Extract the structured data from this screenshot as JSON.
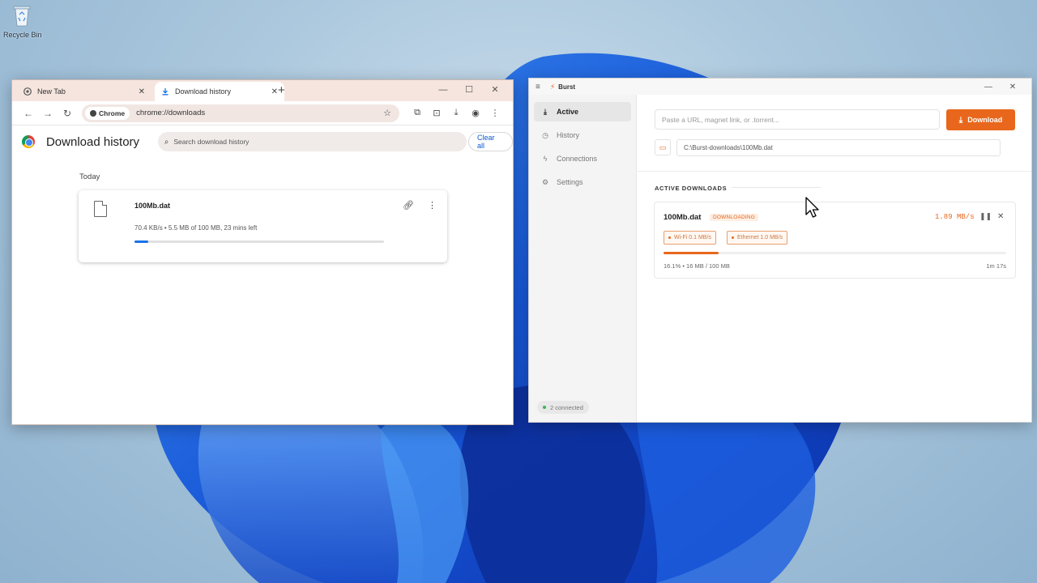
{
  "desktop": {
    "recycle_bin_label": "Recycle Bin"
  },
  "chrome": {
    "tabs": [
      {
        "label": "New Tab",
        "icon": "chrome-icon"
      },
      {
        "label": "Download history",
        "icon": "download-icon",
        "active": true
      }
    ],
    "new_tab_symbol": "+",
    "address": {
      "chip_label": "Chrome",
      "url": "chrome://downloads"
    },
    "page": {
      "title": "Download history",
      "search_placeholder": "Search download history",
      "clear_all_label": "Clear all",
      "group_label": "Today",
      "items": [
        {
          "filename": "100Mb.dat",
          "status": "70.4 KB/s • 5.5 MB of 100 MB, 23 mins left",
          "progress_pct": 5.5
        }
      ]
    }
  },
  "burst": {
    "app_name": "Burst",
    "nav": [
      {
        "label": "Active",
        "icon": "download-icon",
        "active": true
      },
      {
        "label": "History",
        "icon": "history-icon"
      },
      {
        "label": "Connections",
        "icon": "connections-icon"
      },
      {
        "label": "Settings",
        "icon": "gear-icon"
      }
    ],
    "connected_label": "2 connected",
    "url_placeholder": "Paste a URL, magnet link, or .torrent...",
    "download_button_label": "Download",
    "save_path": "C:\\Burst-downloads\\100Mb.dat",
    "section_title": "ACTIVE DOWNLOADS",
    "active": {
      "filename": "100Mb.dat",
      "status": "DOWNLOADING",
      "speed": "1.89 MB/s",
      "connections": [
        {
          "label": "Wi-Fi 0.1 MB/s"
        },
        {
          "label": "Ethernet 1.0 MB/s"
        }
      ],
      "progress_pct": 16.1,
      "meta": "16.1% • 16 MB / 100 MB",
      "eta": "1m 17s"
    },
    "accent_color": "#e8671c"
  }
}
